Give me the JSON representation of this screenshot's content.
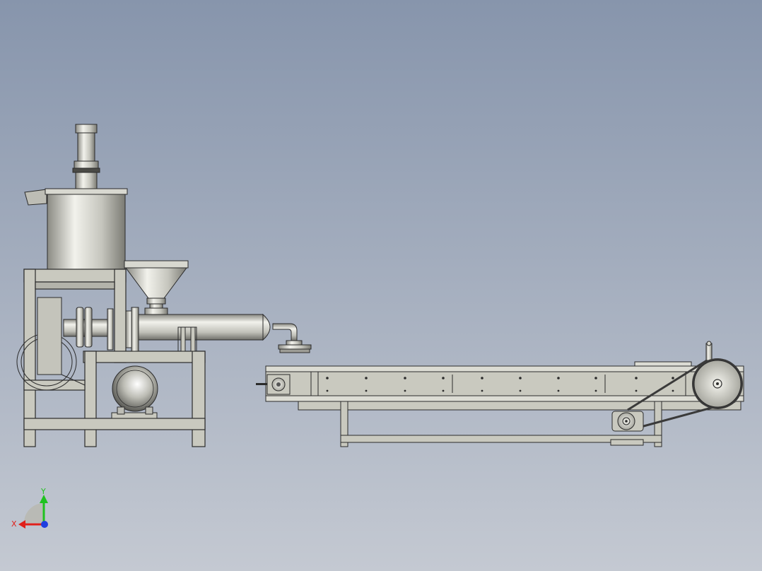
{
  "viewport": {
    "background_top": "#8795ac",
    "background_bottom": "#c4c9d2"
  },
  "colors": {
    "metal_light": "#e6e6e0",
    "metal_mid": "#bdbdb5",
    "metal_dark": "#7d7d76",
    "frame_fill": "#c9c9bf",
    "outline": "#2b2b2b",
    "belt": "#3a3a3a"
  },
  "assembly": {
    "components": [
      "mixer-motor",
      "mixing-tank",
      "machine-frame",
      "feed-hopper",
      "coupling",
      "extruder-barrel",
      "drive-motor",
      "outlet-nozzle",
      "conveyor-belt",
      "conveyor-frame",
      "drive-pulley",
      "gear-motor",
      "drive-chain"
    ]
  },
  "triad": {
    "x_label": "X",
    "y_label": "Y",
    "x_color": "#e0201a",
    "y_color": "#1fc21f",
    "z_color": "#1f3fe0"
  }
}
